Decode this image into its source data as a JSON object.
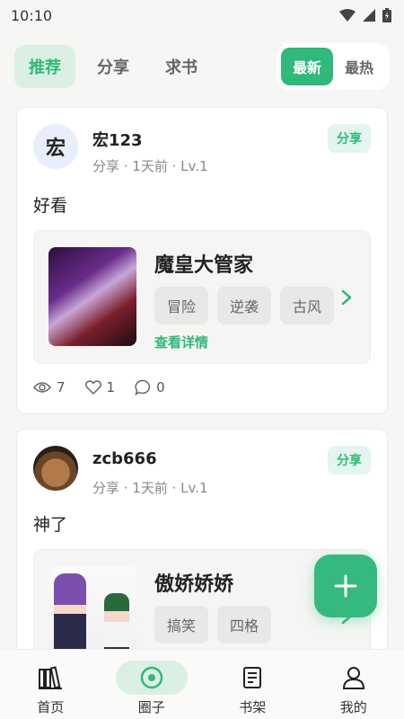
{
  "status_bar": {
    "time": "10:10",
    "icons": [
      "wifi-icon",
      "signal-icon",
      "battery-icon"
    ]
  },
  "tabs": [
    {
      "label": "推荐",
      "active": true
    },
    {
      "label": "分享",
      "active": false
    },
    {
      "label": "求书",
      "active": false
    }
  ],
  "sort": {
    "options": [
      {
        "label": "最新",
        "active": true
      },
      {
        "label": "最热",
        "active": false
      }
    ]
  },
  "posts": [
    {
      "avatar_text": "宏",
      "username": "宏123",
      "meta": "分享 · 1天前 · Lv.1",
      "badge": "分享",
      "text": "好看",
      "book": {
        "title": "魔皇大管家",
        "tags": [
          "冒险",
          "逆袭",
          "古风"
        ],
        "detail_link": "查看详情"
      },
      "stats": {
        "views": "7",
        "likes": "1",
        "comments": "0"
      }
    },
    {
      "avatar_text": "",
      "username": "zcb666",
      "meta": "分享 · 1天前 · Lv.1",
      "badge": "分享",
      "text": "神了",
      "book": {
        "title": "傲娇娇娇",
        "tags": [
          "搞笑",
          "四格"
        ]
      }
    }
  ],
  "bottom_nav": [
    {
      "label": "首页",
      "icon": "bookshelf-icon",
      "active": false
    },
    {
      "label": "圈子",
      "icon": "circle-target-icon",
      "active": true
    },
    {
      "label": "书架",
      "icon": "book-icon",
      "active": false
    },
    {
      "label": "我的",
      "icon": "user-icon",
      "active": false
    }
  ],
  "colors": {
    "accent": "#2fb97a",
    "accent_light": "#dcefe4",
    "background": "#f6f6f4"
  }
}
